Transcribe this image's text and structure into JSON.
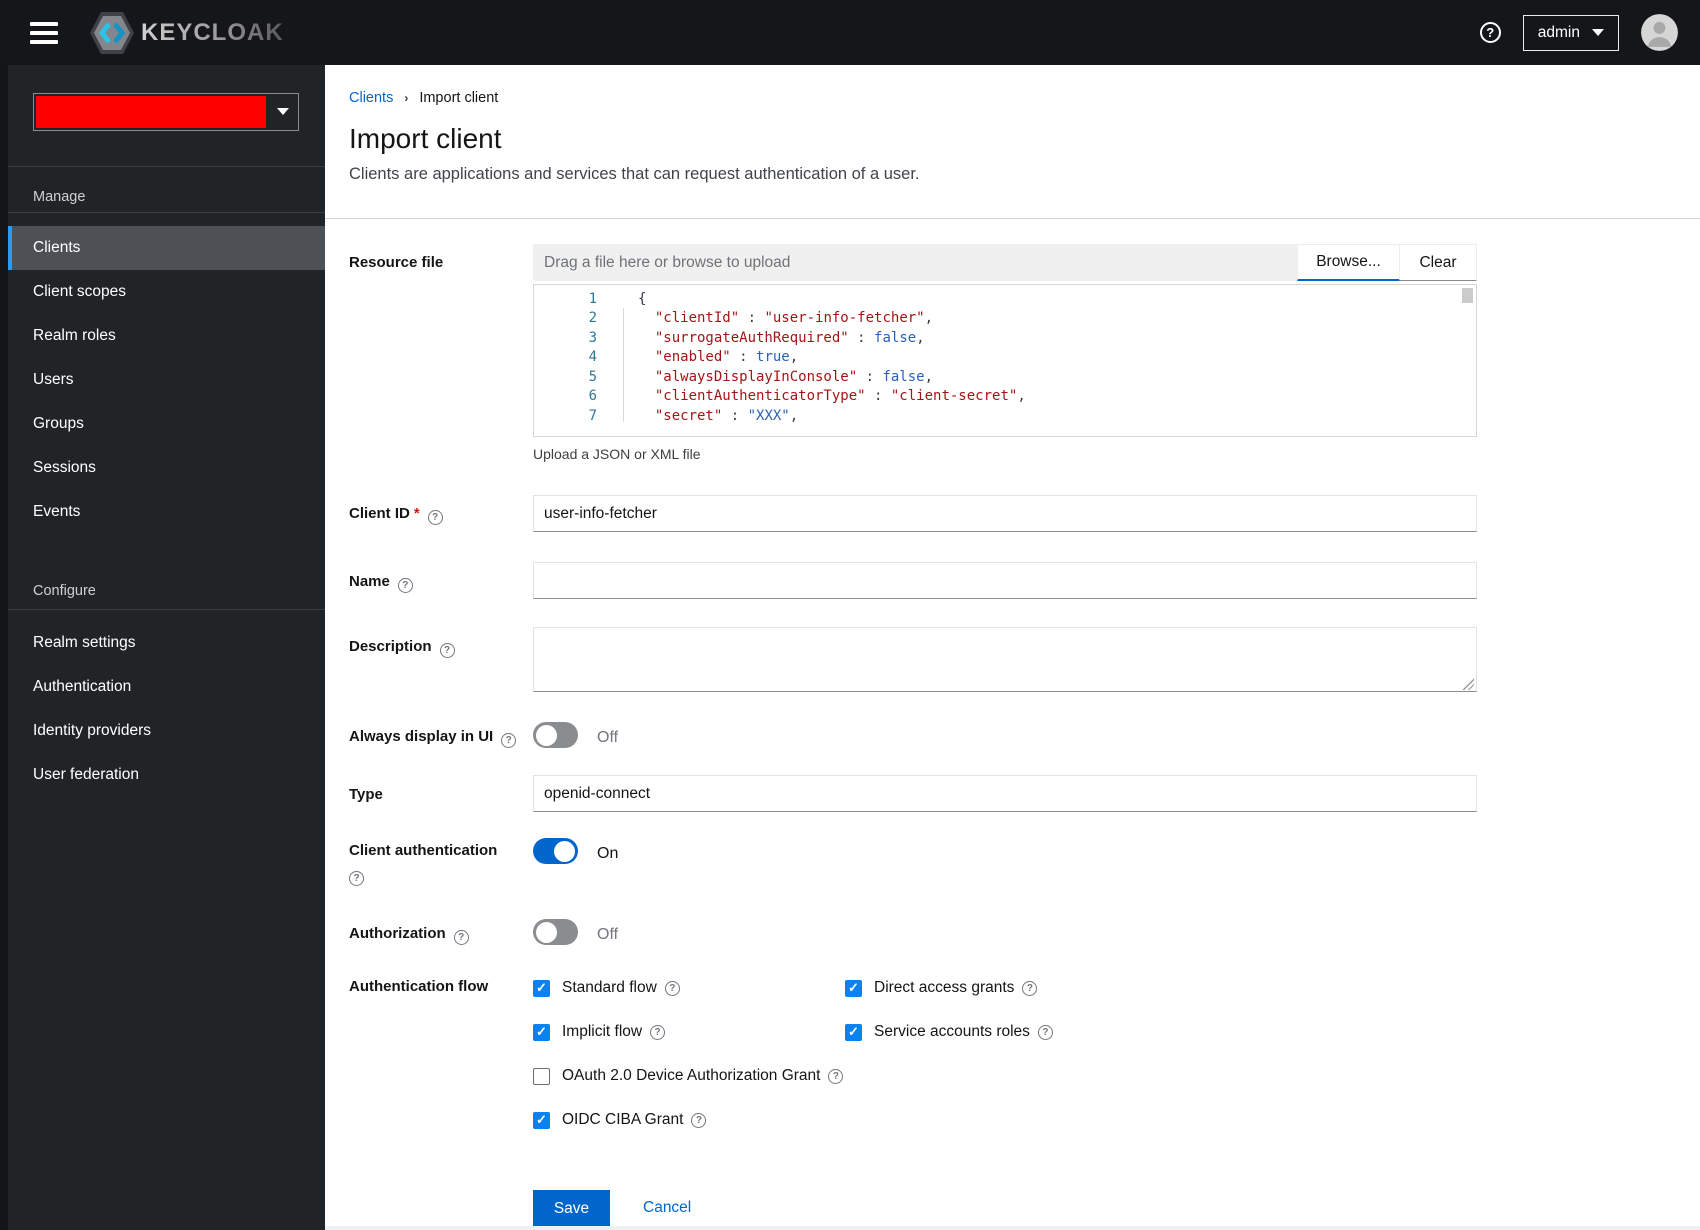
{
  "header": {
    "brand": "KEYCLOAK",
    "user": "admin"
  },
  "sidebar": {
    "sections": [
      {
        "title": "Manage",
        "items": [
          {
            "label": "Clients",
            "active": true
          },
          {
            "label": "Client scopes"
          },
          {
            "label": "Realm roles"
          },
          {
            "label": "Users"
          },
          {
            "label": "Groups"
          },
          {
            "label": "Sessions"
          },
          {
            "label": "Events"
          }
        ]
      },
      {
        "title": "Configure",
        "items": [
          {
            "label": "Realm settings"
          },
          {
            "label": "Authentication"
          },
          {
            "label": "Identity providers"
          },
          {
            "label": "User federation"
          }
        ]
      }
    ]
  },
  "breadcrumb": {
    "parent": "Clients",
    "separator": "›",
    "current": "Import client"
  },
  "page": {
    "title": "Import client",
    "subtitle": "Clients are applications and services that can request authentication of a user."
  },
  "upload": {
    "label": "Resource file",
    "placeholder": "Drag a file here or browse to upload",
    "browse_label": "Browse...",
    "clear_label": "Clear",
    "helper": "Upload a JSON or XML file"
  },
  "editor": {
    "lines": [
      {
        "n": "1",
        "parts": [
          {
            "text": "{",
            "cls": "brace"
          }
        ]
      },
      {
        "n": "2",
        "parts": [
          {
            "text": "  ",
            "cls": "op"
          },
          {
            "text": "\"clientId\"",
            "cls": "key"
          },
          {
            "text": " : ",
            "cls": "op"
          },
          {
            "text": "\"user-info-fetcher\"",
            "cls": "str"
          },
          {
            "text": ",",
            "cls": "op"
          }
        ]
      },
      {
        "n": "3",
        "parts": [
          {
            "text": "  ",
            "cls": "op"
          },
          {
            "text": "\"surrogateAuthRequired\"",
            "cls": "key"
          },
          {
            "text": " : ",
            "cls": "op"
          },
          {
            "text": "false",
            "cls": "bool"
          },
          {
            "text": ",",
            "cls": "op"
          }
        ]
      },
      {
        "n": "4",
        "parts": [
          {
            "text": "  ",
            "cls": "op"
          },
          {
            "text": "\"enabled\"",
            "cls": "key"
          },
          {
            "text": " : ",
            "cls": "op"
          },
          {
            "text": "true",
            "cls": "bool"
          },
          {
            "text": ",",
            "cls": "op"
          }
        ]
      },
      {
        "n": "5",
        "parts": [
          {
            "text": "  ",
            "cls": "op"
          },
          {
            "text": "\"alwaysDisplayInConsole\"",
            "cls": "key"
          },
          {
            "text": " : ",
            "cls": "op"
          },
          {
            "text": "false",
            "cls": "bool"
          },
          {
            "text": ",",
            "cls": "op"
          }
        ]
      },
      {
        "n": "6",
        "parts": [
          {
            "text": "  ",
            "cls": "op"
          },
          {
            "text": "\"clientAuthenticatorType\"",
            "cls": "key"
          },
          {
            "text": " : ",
            "cls": "op"
          },
          {
            "text": "\"client-secret\"",
            "cls": "str"
          },
          {
            "text": ",",
            "cls": "op"
          }
        ]
      },
      {
        "n": "7",
        "parts": [
          {
            "text": "  ",
            "cls": "op"
          },
          {
            "text": "\"secret\"",
            "cls": "key"
          },
          {
            "text": " : ",
            "cls": "op"
          },
          {
            "text": "\"XXX\"",
            "cls": "strblue"
          },
          {
            "text": ",",
            "cls": "op"
          }
        ]
      }
    ]
  },
  "fields": {
    "client_id": {
      "label": "Client ID",
      "required": "*",
      "value": "user-info-fetcher"
    },
    "name": {
      "label": "Name",
      "value": ""
    },
    "description": {
      "label": "Description",
      "value": ""
    },
    "always_display": {
      "label": "Always display in UI",
      "state": "Off"
    },
    "type": {
      "label": "Type",
      "value": "openid-connect"
    },
    "client_auth": {
      "label": "Client authentication",
      "state": "On"
    },
    "authorization": {
      "label": "Authorization",
      "state": "Off"
    },
    "auth_flow": {
      "label": "Authentication flow",
      "col1": [
        {
          "label": "Standard flow",
          "checked": true
        },
        {
          "label": "Implicit flow",
          "checked": true
        },
        {
          "label": "OAuth 2.0 Device Authorization Grant",
          "checked": false
        },
        {
          "label": "OIDC CIBA Grant",
          "checked": true
        }
      ],
      "col2": [
        {
          "label": "Direct access grants",
          "checked": true
        },
        {
          "label": "Service accounts roles",
          "checked": true
        }
      ]
    }
  },
  "actions": {
    "save": "Save",
    "cancel": "Cancel"
  },
  "colors": {
    "primary": "#0066cc",
    "checkbox_checked": "#0d80f2",
    "nav_active_indicator": "#2b9af3",
    "realm_redaction": "#fe0000",
    "masthead_bg": "#141619",
    "sidebar_bg": "#212427"
  }
}
